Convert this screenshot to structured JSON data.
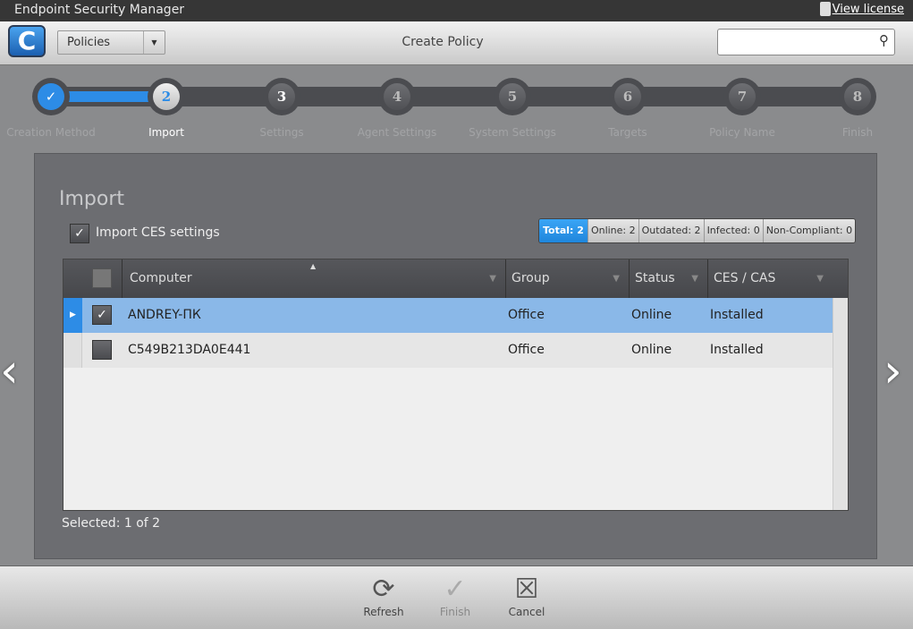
{
  "app": {
    "title": "Endpoint Security Manager",
    "view_license": "View license"
  },
  "toolbar": {
    "module": "Policies",
    "page_title": "Create Policy",
    "search_placeholder": ""
  },
  "steps": [
    {
      "num": "✓",
      "label": "Creation Method",
      "state": "done"
    },
    {
      "num": "2",
      "label": "Import",
      "state": "current"
    },
    {
      "num": "3",
      "label": "Settings",
      "state": "pending"
    },
    {
      "num": "4",
      "label": "Agent Settings",
      "state": "pending"
    },
    {
      "num": "5",
      "label": "System Settings",
      "state": "pending"
    },
    {
      "num": "6",
      "label": "Targets",
      "state": "pending"
    },
    {
      "num": "7",
      "label": "Policy Name",
      "state": "pending"
    },
    {
      "num": "8",
      "label": "Finish",
      "state": "pending"
    }
  ],
  "panel": {
    "heading": "Import",
    "import_ces_label": "Import CES settings",
    "import_ces_checked": true,
    "stats": [
      "Total: 2",
      "Online: 2",
      "Outdated: 2",
      "Infected: 0",
      "Non-Compliant: 0"
    ],
    "columns": [
      "Computer",
      "Group",
      "Status",
      "CES / CAS"
    ],
    "rows": [
      {
        "checked": true,
        "computer": "ANDREY-ПК",
        "group": "Office",
        "status": "Online",
        "ces": "Installed"
      },
      {
        "checked": false,
        "computer": "C549B213DA0E441",
        "group": "Office",
        "status": "Online",
        "ces": "Installed"
      }
    ],
    "selected": "Selected: 1 of 2"
  },
  "actions": {
    "refresh": "Refresh",
    "finish": "Finish",
    "cancel": "Cancel"
  },
  "colors": {
    "accent": "#2d8ce6",
    "selected_row": "#8ab8e8"
  }
}
